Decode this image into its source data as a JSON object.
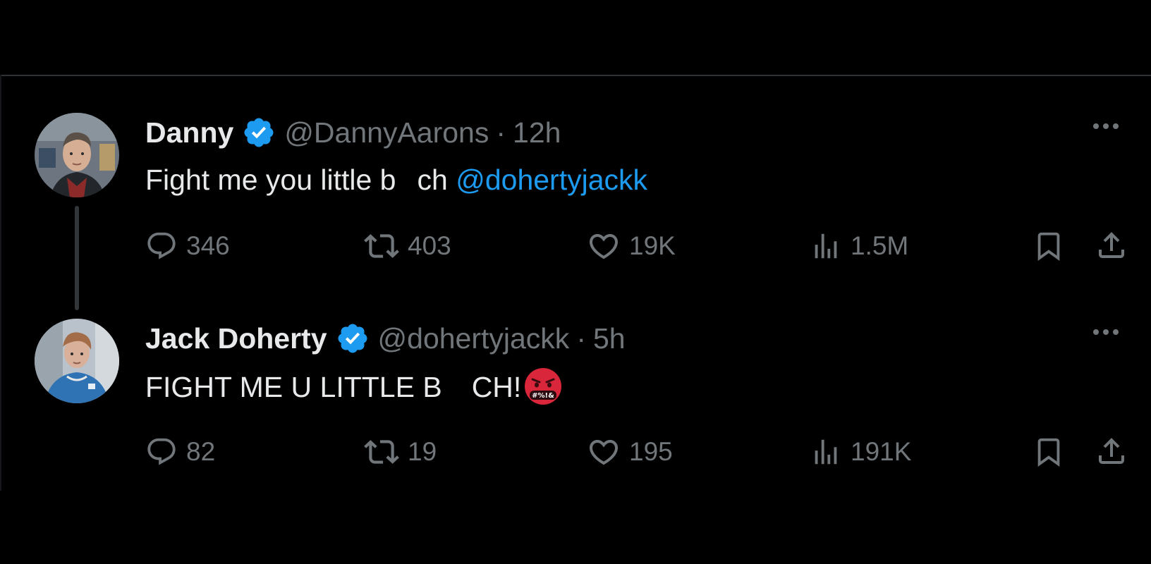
{
  "tweets": [
    {
      "name": "Danny",
      "handle": "@DannyAarons",
      "separator": "·",
      "time": "12h",
      "text_part1": "Fight me you little b",
      "text_part2": "ch",
      "mention": "@dohertyjackk",
      "replies": "346",
      "retweets": "403",
      "likes": "19K",
      "views": "1.5M",
      "verified": true
    },
    {
      "name": "Jack Doherty",
      "handle": "@dohertyjackk",
      "separator": "·",
      "time": "5h",
      "text_part1": "FIGHT ME U LITTLE B",
      "text_part2": "CH!",
      "emoji": "🤬",
      "emoji_name": "face-with-symbols-on-mouth",
      "replies": "82",
      "retweets": "19",
      "likes": "195",
      "views": "191K",
      "verified": true
    }
  ],
  "colors": {
    "background": "#000000",
    "text_primary": "#e7e9ea",
    "text_secondary": "#71767b",
    "accent": "#1d9bf0",
    "divider": "#2f3336"
  }
}
